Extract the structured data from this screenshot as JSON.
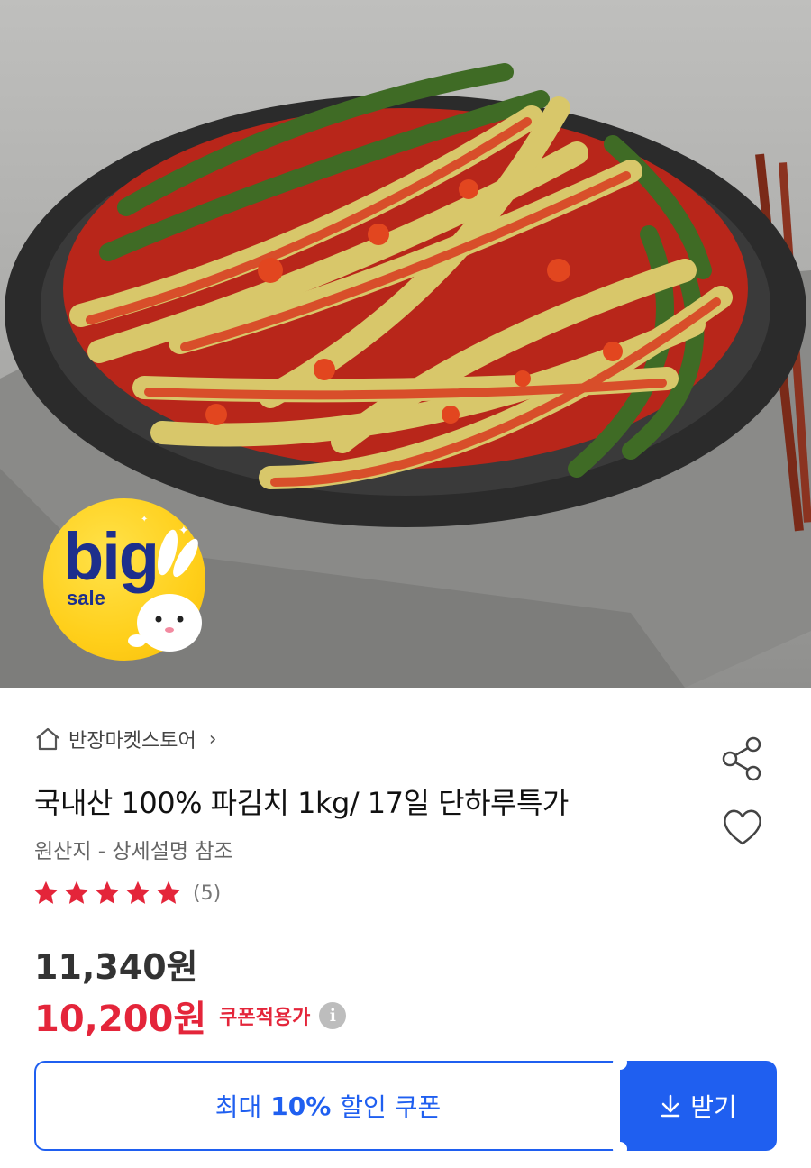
{
  "hero": {
    "badge_big": "big",
    "badge_sale": "sale"
  },
  "store": {
    "name": "반장마켓스토어",
    "chevron": "›"
  },
  "product": {
    "title": "국내산 100% 파김치 1kg/ 17일 단하루특가",
    "origin": "원산지 - 상세설명 참조",
    "rating": {
      "stars": 5,
      "count_text": "(5)"
    },
    "price_original": "11,340원",
    "price_coupon": "10,200원",
    "coupon_label": "쿠폰적용가",
    "info_icon_glyph": "i"
  },
  "coupon": {
    "prefix": "최대",
    "percent": "10%",
    "suffix": "할인 쿠폰",
    "get_label": "받기"
  },
  "colors": {
    "accent_blue": "#1f5ff0",
    "sale_red": "#e4253a",
    "badge_yellow": "#ffcf1a",
    "badge_navy": "#1d2f8c"
  },
  "icons": [
    "home-icon",
    "chevron-right-icon",
    "share-icon",
    "heart-icon",
    "star-icon",
    "info-icon",
    "download-icon",
    "rabbit-icon"
  ]
}
